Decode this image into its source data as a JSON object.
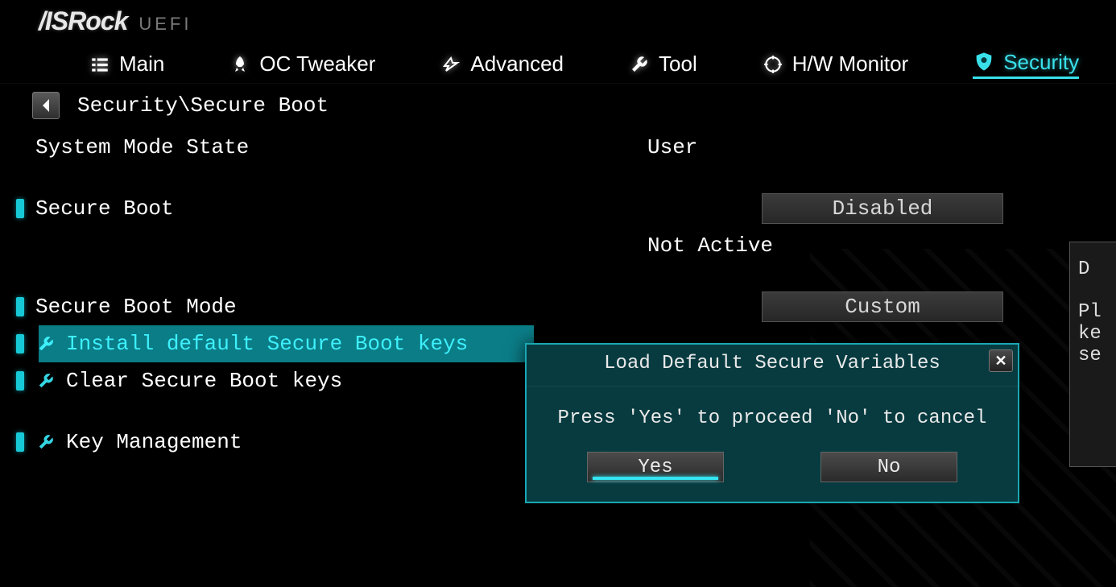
{
  "logo": {
    "brand": "/ISRock",
    "sub": "UEFI"
  },
  "nav": {
    "main": "Main",
    "oc": "OC Tweaker",
    "adv": "Advanced",
    "tool": "Tool",
    "hw": "H/W Monitor",
    "sec": "Security"
  },
  "breadcrumb": "Security\\Secure Boot",
  "rows": {
    "system_mode_label": "System Mode State",
    "system_mode_value": "User",
    "secure_boot_label": "Secure Boot",
    "secure_boot_value": "Disabled",
    "secure_boot_status": "Not Active",
    "secure_boot_mode_label": "Secure Boot Mode",
    "secure_boot_mode_value": "Custom",
    "install_keys": "Install default Secure Boot keys",
    "clear_keys": "Clear Secure Boot keys",
    "key_mgmt": "Key Management"
  },
  "help": {
    "l1": "D",
    "l2": "Pl",
    "l3": "ke",
    "l4": "se"
  },
  "modal": {
    "title": "Load Default Secure Variables",
    "body": "Press 'Yes' to proceed 'No' to cancel",
    "yes": "Yes",
    "no": "No"
  }
}
